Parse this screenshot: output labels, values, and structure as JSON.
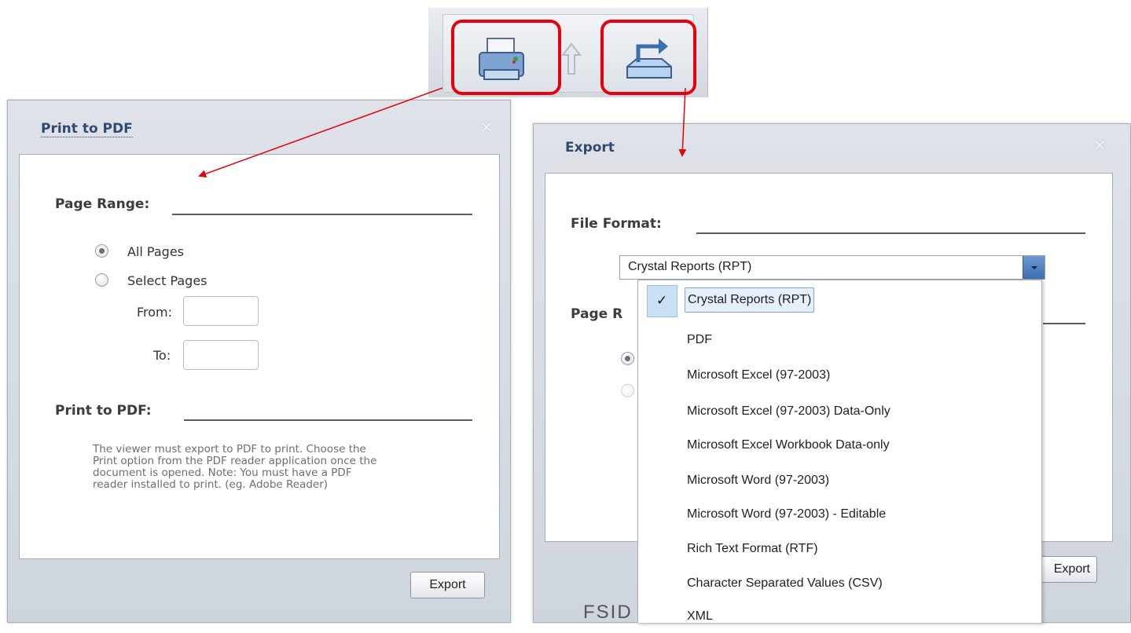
{
  "colors": {
    "annotation_red": "#e8000c",
    "dialog_header": "#d7dce3",
    "title_text": "#2e4a6e",
    "dropdown_arrow": "#4a7bbd"
  },
  "toolbar": {
    "print_icon": "printer-icon",
    "up_icon": "up-arrow-icon",
    "export_icon": "export-icon"
  },
  "print_dialog": {
    "title": "Print to PDF",
    "close_icon": "close-icon",
    "page_range_label": "Page Range:",
    "all_pages_label": "All Pages",
    "select_pages_label": "Select Pages",
    "from_label": "From:",
    "to_label": "To:",
    "from_value": "",
    "to_value": "",
    "print_section_label": "Print to PDF:",
    "note_lines": [
      "The viewer must export to PDF to print. Choose the",
      "Print option from the PDF reader application once the",
      "document is opened. Note: You must have a PDF",
      "reader installed to print. (eg. Adobe Reader)"
    ],
    "export_button": "Export"
  },
  "export_dialog": {
    "title": "Export",
    "close_icon": "close-icon",
    "file_format_label": "File Format:",
    "selected_format": "Crystal Reports (RPT)",
    "page_range_partial": "Page R",
    "export_button_partial": "Export",
    "formats": [
      "Crystal Reports (RPT)",
      "PDF",
      "Microsoft Excel (97-2003)",
      "Microsoft Excel (97-2003) Data-Only",
      "Microsoft Excel Workbook Data-only",
      "Microsoft Word (97-2003)",
      "Microsoft Word (97-2003) - Editable",
      "Rich Text Format (RTF)",
      "Character Separated Values (CSV)",
      "XML"
    ]
  },
  "background_text": "FSID"
}
